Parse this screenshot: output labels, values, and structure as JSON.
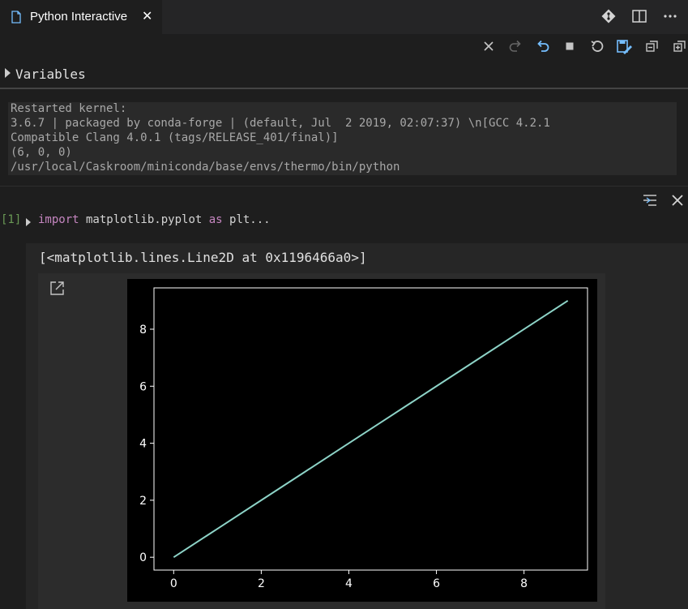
{
  "tab": {
    "title": "Python Interactive",
    "close_glyph": "✕"
  },
  "icons": {
    "file": "file-icon",
    "git": "git-compare-icon",
    "split": "split-editor-icon",
    "more": "more-actions-icon"
  },
  "toolbar": {
    "items": [
      "clear-all-icon",
      "redo-icon",
      "undo-icon",
      "interrupt-icon",
      "restart-icon",
      "export-icon",
      "collapse-all-icon",
      "expand-all-icon"
    ]
  },
  "variables": {
    "label": "Variables"
  },
  "sysinfo": {
    "lines": [
      "Restarted kernel:",
      "3.6.7 | packaged by conda-forge | (default, Jul  2 2019, 02:07:37) \\n[GCC 4.2.1",
      "Compatible Clang 4.0.1 (tags/RELEASE_401/final)]",
      "(6, 0, 0)",
      "/usr/local/Caskroom/miniconda/base/envs/thermo/bin/python"
    ]
  },
  "cell": {
    "exec_count": "[1]",
    "code_keyword1": "import",
    "code_module": " matplotlib.pyplot ",
    "code_keyword2": "as",
    "code_rest": " plt...",
    "output_text": "[<matplotlib.lines.Line2D at 0x1196466a0>]"
  },
  "colors": {
    "background": "#1e1e1e",
    "line": "#8dd3c7",
    "keyword": "#c586c0",
    "exec_count": "#6a9955",
    "accent_blue": "#75beff"
  },
  "chart_data": {
    "type": "line",
    "title": "",
    "xlabel": "",
    "ylabel": "",
    "x": [
      0,
      1,
      2,
      3,
      4,
      5,
      6,
      7,
      8,
      9
    ],
    "series": [
      {
        "values": [
          0,
          1,
          2,
          3,
          4,
          5,
          6,
          7,
          8,
          9
        ]
      }
    ],
    "xlim": [
      -0.45,
      9.45
    ],
    "ylim": [
      -0.45,
      9.45
    ],
    "xticks": [
      0,
      2,
      4,
      6,
      8
    ],
    "yticks": [
      0,
      2,
      4,
      6,
      8
    ],
    "grid": false
  }
}
